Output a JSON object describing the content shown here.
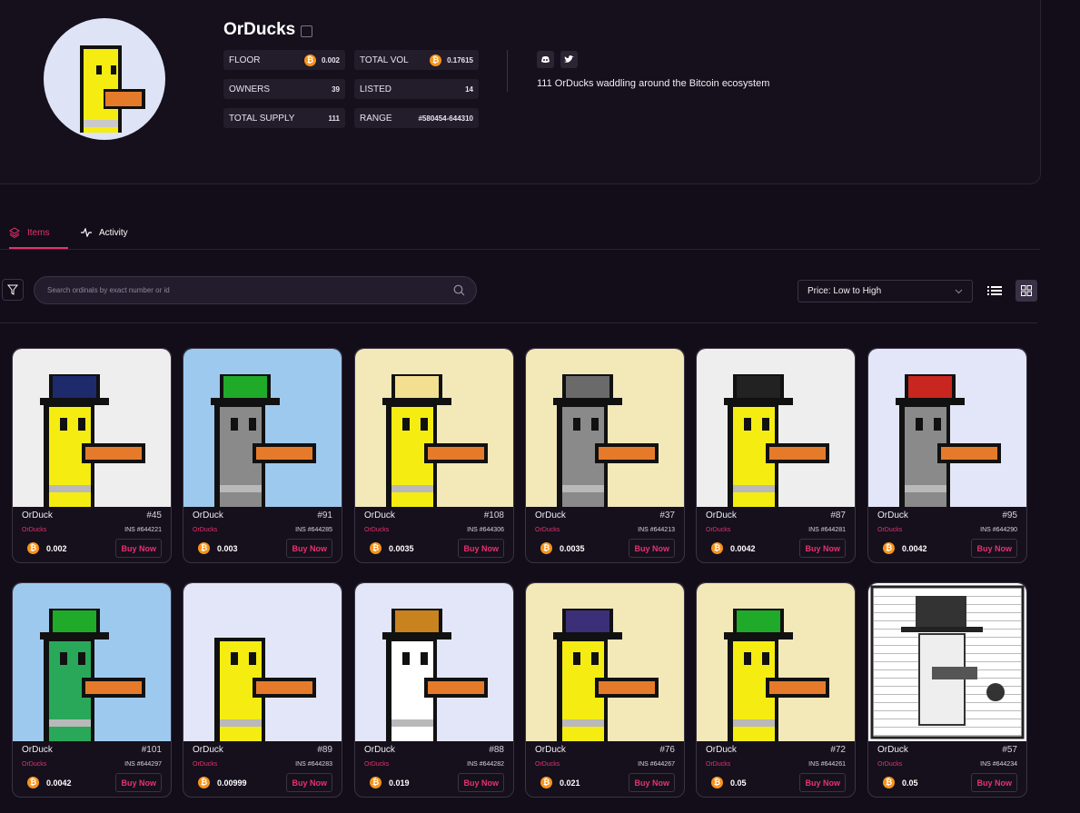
{
  "collection": {
    "name": "OrDucks",
    "description": "111 OrDucks waddling around the Bitcoin ecosystem",
    "stats": [
      {
        "label": "FLOOR",
        "value": "0.002",
        "btc": true
      },
      {
        "label": "TOTAL VOL",
        "value": "0.17615",
        "btc": true
      },
      {
        "label": "OWNERS",
        "value": "39",
        "btc": false
      },
      {
        "label": "LISTED",
        "value": "14",
        "btc": false
      },
      {
        "label": "TOTAL SUPPLY",
        "value": "111",
        "btc": false
      },
      {
        "label": "RANGE",
        "value": "#580454-644310",
        "btc": false
      }
    ],
    "socials": [
      {
        "name": "discord-icon"
      },
      {
        "name": "twitter-icon"
      }
    ]
  },
  "tabs": [
    {
      "label": "Items",
      "active": true,
      "icon": "layers-icon"
    },
    {
      "label": "Activity",
      "active": false,
      "icon": "activity-icon"
    }
  ],
  "toolbar": {
    "search_placeholder": "Search ordinals by exact number or id",
    "sort_value": "Price: Low to High",
    "view_modes": [
      "list-view-icon",
      "grid-view-icon"
    ],
    "active_view": "grid-view-icon"
  },
  "btc_symbol": "₿",
  "buy_label": "Buy Now",
  "items": [
    {
      "name": "OrDuck",
      "number": "#45",
      "collection": "OrDucks",
      "ins": "INS #644221",
      "price": "0.002",
      "bg": "#eeeeee"
    },
    {
      "name": "OrDuck",
      "number": "#91",
      "collection": "OrDucks",
      "ins": "INS #644285",
      "price": "0.003",
      "bg": "#9ec9ee"
    },
    {
      "name": "OrDuck",
      "number": "#108",
      "collection": "OrDucks",
      "ins": "INS #644306",
      "price": "0.0035",
      "bg": "#f2e8b8"
    },
    {
      "name": "OrDuck",
      "number": "#37",
      "collection": "OrDucks",
      "ins": "INS #644213",
      "price": "0.0035",
      "bg": "#f2e8b8"
    },
    {
      "name": "OrDuck",
      "number": "#87",
      "collection": "OrDucks",
      "ins": "INS #644281",
      "price": "0.0042",
      "bg": "#eeeeee"
    },
    {
      "name": "OrDuck",
      "number": "#95",
      "collection": "OrDucks",
      "ins": "INS #644290",
      "price": "0.0042",
      "bg": "#e2e6f8"
    },
    {
      "name": "OrDuck",
      "number": "#101",
      "collection": "OrDucks",
      "ins": "INS #644297",
      "price": "0.0042",
      "bg": "#9ec9ee"
    },
    {
      "name": "OrDuck",
      "number": "#89",
      "collection": "OrDucks",
      "ins": "INS #644283",
      "price": "0.00999",
      "bg": "#e2e6f8"
    },
    {
      "name": "OrDuck",
      "number": "#88",
      "collection": "OrDucks",
      "ins": "INS #644282",
      "price": "0.019",
      "bg": "#e2e6f8"
    },
    {
      "name": "OrDuck",
      "number": "#76",
      "collection": "OrDucks",
      "ins": "INS #644267",
      "price": "0.021",
      "bg": "#f2e8b8"
    },
    {
      "name": "OrDuck",
      "number": "#72",
      "collection": "OrDucks",
      "ins": "INS #644261",
      "price": "0.05",
      "bg": "#f2e8b8"
    },
    {
      "name": "OrDuck",
      "number": "#57",
      "collection": "OrDucks",
      "ins": "INS #644234",
      "price": "0.05",
      "bg": "#ffffff"
    }
  ]
}
